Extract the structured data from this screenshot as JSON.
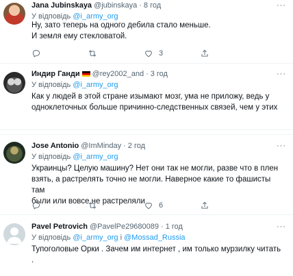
{
  "tweets": [
    {
      "name": "Jana Jubinskaya",
      "handle": "@jubinskaya",
      "time": "8 год",
      "reply_prefix": "У відповідь",
      "reply_to": "@i_army_org",
      "reply_joiner": "",
      "reply_to2": "",
      "lines": [
        "Ну, зато теперь на одного дебила стало меньше.",
        "И земля ему стекловатой."
      ],
      "likes": "3"
    },
    {
      "name": "Индир Ганди",
      "handle": "@rey2002_and",
      "time": "3 год",
      "reply_prefix": "У відповідь",
      "reply_to": "@i_army_org",
      "reply_joiner": "",
      "reply_to2": "",
      "lines": [
        "Как у людей в этой стране изымают мозг, ума не приложу, ведь у",
        "одноклеточных больше причинно-следственных связей, чем у этих"
      ],
      "likes": ""
    },
    {
      "name": "Jose Antonio",
      "handle": "@ImMinday",
      "time": "2 год",
      "reply_prefix": "У відповідь",
      "reply_to": "@i_army_org",
      "reply_joiner": "",
      "reply_to2": "",
      "lines": [
        "Украинцы? Целую машину? Нет они так не могли, разве что в плен",
        "взять, а растрелять точно не могли. Наверное какие то фашисты там",
        "были или вовсе не растреляли"
      ],
      "likes": "6"
    },
    {
      "name": "Pavel Petrovich",
      "handle": "@PavelPe29680089",
      "time": "1 год",
      "reply_prefix": "У відповідь",
      "reply_to": "@i_army_org",
      "reply_joiner": "і",
      "reply_to2": "@Mossad_Russia",
      "lines": [
        "Тупоголовые Орки . Зачем им интернет , им только мурзилку читать ."
      ],
      "likes": ""
    }
  ],
  "icons": {
    "more": "more-horizontal-icon",
    "reply": "reply-icon",
    "retweet": "retweet-icon",
    "like": "like-icon",
    "share": "share-icon",
    "flag": "german-flag-icon"
  }
}
